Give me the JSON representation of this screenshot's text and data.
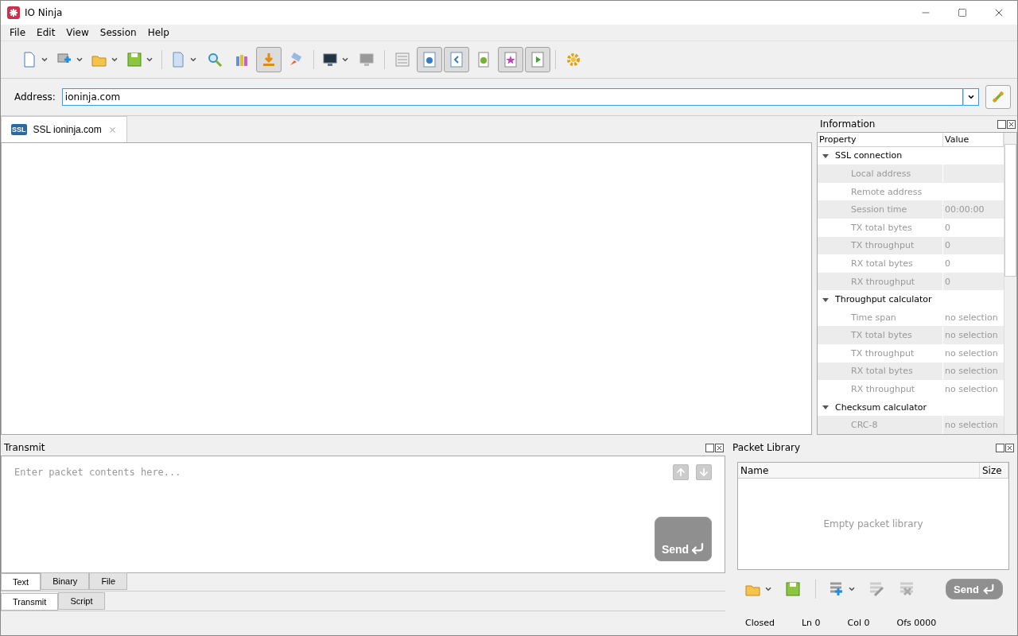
{
  "window": {
    "title": "IO Ninja"
  },
  "menu": [
    "File",
    "Edit",
    "View",
    "Session",
    "Help"
  ],
  "toolbar": [
    [
      {
        "pressed": false,
        "menu": true
      },
      {
        "pressed": false,
        "menu": true
      },
      {
        "pressed": false,
        "menu": true
      },
      {
        "pressed": false,
        "menu": true
      }
    ],
    [
      {
        "pressed": false,
        "menu": true
      },
      {
        "pressed": false,
        "menu": false
      },
      {
        "pressed": false,
        "menu": false
      },
      {
        "pressed": true,
        "menu": false
      },
      {
        "pressed": false,
        "menu": false
      }
    ],
    [
      {
        "pressed": false,
        "menu": true
      },
      {
        "pressed": false,
        "menu": false
      }
    ],
    [
      {
        "pressed": false,
        "menu": false
      },
      {
        "pressed": true,
        "menu": false
      },
      {
        "pressed": true,
        "menu": false
      },
      {
        "pressed": false,
        "menu": false
      },
      {
        "pressed": true,
        "menu": false
      },
      {
        "pressed": true,
        "menu": false
      }
    ],
    [
      {
        "pressed": false,
        "menu": false
      }
    ]
  ],
  "address": {
    "label": "Address:",
    "value": "ioninja.com"
  },
  "session_tabs": [
    {
      "badge": "SSL",
      "label": "SSL ioninja.com",
      "selected": true
    }
  ],
  "information": {
    "title": "Information",
    "columns": [
      "Property",
      "Value"
    ],
    "groups": [
      {
        "name": "SSL connection",
        "expanded": true,
        "children": [
          {
            "property": "Local address"
          },
          {
            "property": "Remote address"
          },
          {
            "property": "Session time",
            "value": "00:00:00"
          },
          {
            "property": "TX total bytes",
            "value": "0"
          },
          {
            "property": "TX throughput",
            "value": "0"
          },
          {
            "property": "RX total bytes",
            "value": "0"
          },
          {
            "property": "RX throughput",
            "value": "0"
          }
        ]
      },
      {
        "name": "Throughput calculator",
        "expanded": true,
        "children": [
          {
            "property": "Time span",
            "value": "no selection"
          },
          {
            "property": "TX total bytes",
            "value": "no selection"
          },
          {
            "property": "TX throughput",
            "value": "no selection"
          },
          {
            "property": "RX total bytes",
            "value": "no selection"
          },
          {
            "property": "RX throughput",
            "value": "no selection"
          }
        ]
      },
      {
        "name": "Checksum calculator",
        "expanded": true,
        "children": [
          {
            "property": "CRC-8",
            "value": "no selection"
          }
        ]
      }
    ]
  },
  "transmit": {
    "title": "Transmit",
    "placeholder": "Enter packet contents here...",
    "send": "Send",
    "format_tabs": [
      {
        "label": "Text",
        "selected": true
      },
      {
        "label": "Binary",
        "selected": false
      },
      {
        "label": "File",
        "selected": false
      }
    ],
    "mode_tabs": [
      {
        "label": "Transmit",
        "selected": true
      },
      {
        "label": "Script",
        "selected": false
      }
    ]
  },
  "packet_library": {
    "title": "Packet Library",
    "columns": [
      "Name",
      "Size"
    ],
    "empty": "Empty packet library",
    "send": "Send"
  },
  "status_bar": [
    "Closed",
    "Ln 0",
    "Col 0",
    "Ofs 0000"
  ]
}
